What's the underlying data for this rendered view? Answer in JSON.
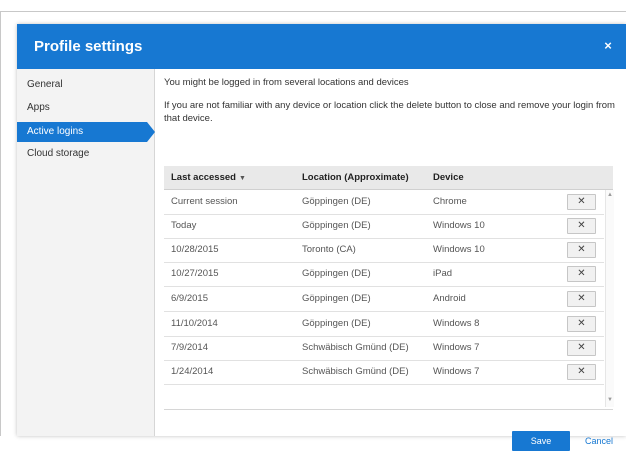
{
  "dialog": {
    "title": "Profile settings",
    "close_label": "×"
  },
  "sidebar": {
    "items": [
      {
        "label": "General"
      },
      {
        "label": "Apps"
      },
      {
        "label": "Active logins"
      },
      {
        "label": "Cloud storage"
      }
    ],
    "active_item": "Active logins"
  },
  "content": {
    "message_1": "You might be logged in from several locations and devices",
    "message_2": "If you are not familiar with any device or location click the delete button to close and remove your login from that device."
  },
  "table": {
    "columns": [
      {
        "label": "Last accessed"
      },
      {
        "label": "Location (Approximate)"
      },
      {
        "label": "Device"
      }
    ],
    "sort_indicator": "▼",
    "delete_label": "✕",
    "rows": [
      {
        "last": "Current session",
        "location": "Göppingen (DE)",
        "device": "Chrome"
      },
      {
        "last": "Today",
        "location": "Göppingen (DE)",
        "device": "Windows 10"
      },
      {
        "last": "10/28/2015",
        "location": "Toronto (CA)",
        "device": "Windows 10"
      },
      {
        "last": "10/27/2015",
        "location": "Göppingen (DE)",
        "device": "iPad"
      },
      {
        "last": "6/9/2015",
        "location": "Göppingen (DE)",
        "device": "Android"
      },
      {
        "last": "11/10/2014",
        "location": "Göppingen (DE)",
        "device": "Windows 8"
      },
      {
        "last": "7/9/2014",
        "location": "Schwäbisch Gmünd (DE)",
        "device": "Windows 7"
      },
      {
        "last": "1/24/2014",
        "location": "Schwäbisch Gmünd (DE)",
        "device": "Windows 7"
      }
    ]
  },
  "footer": {
    "save_label": "Save",
    "cancel_label": "Cancel"
  },
  "colors": {
    "accent": "#1778d2",
    "sidebar_bg": "#f3f3f3",
    "table_header_bg": "#e9e9e9"
  }
}
